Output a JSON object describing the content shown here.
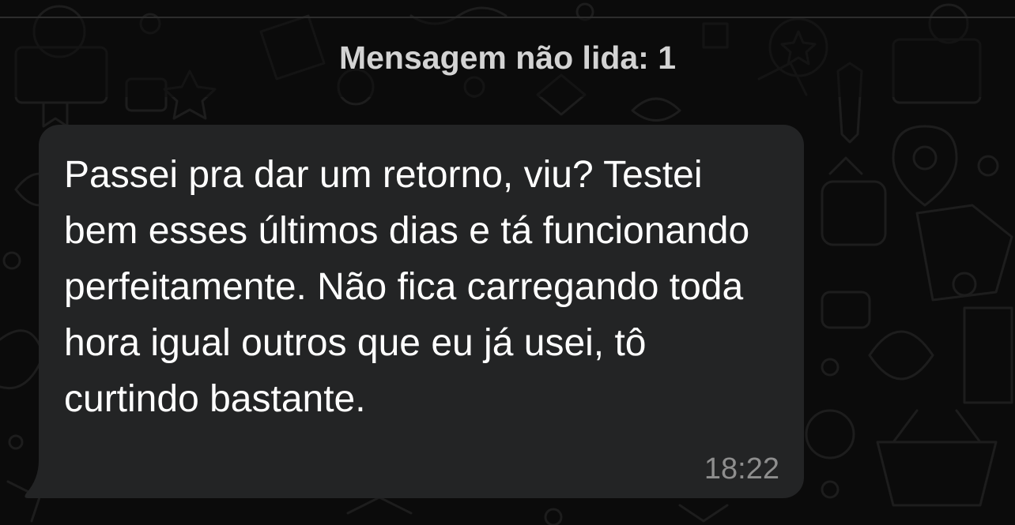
{
  "chat": {
    "unread_banner": "Mensagem não lida: 1",
    "messages": [
      {
        "direction": "incoming",
        "text": "Passei pra dar um retorno, viu? Testei bem esses últimos dias e tá funcionando perfeitamente. Não fica carregando toda hora igual outros que eu já usei, tô curtindo bastante.",
        "time": "18:22"
      }
    ]
  },
  "theme": {
    "background": "#0b0b0b",
    "bubble_incoming": "#232425",
    "text_primary": "#ffffff",
    "text_secondary": "#8e8e8e",
    "banner_text": "#d3d3d3"
  }
}
